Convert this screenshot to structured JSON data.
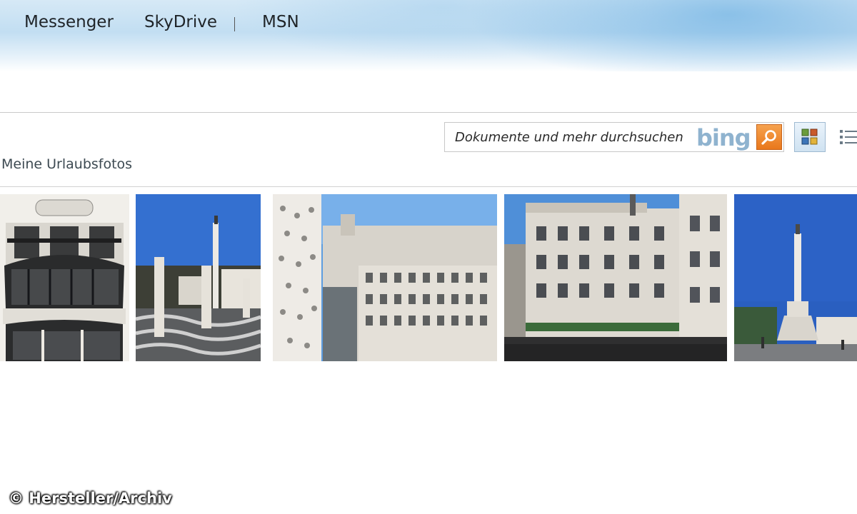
{
  "nav": {
    "items": [
      "Messenger",
      "SkyDrive",
      "MSN"
    ],
    "separator": "|"
  },
  "search": {
    "placeholder": "Dokumente und mehr durchsuchen",
    "provider": "bing",
    "button_icon": "magnifier-icon"
  },
  "view_buttons": {
    "tiles_icon": "thumbnail-view-icon",
    "list_icon": "list-view-icon"
  },
  "folder": {
    "title": "Meine Urlaubsfotos",
    "photo_count": 5
  },
  "colors": {
    "search_button": "#e9781c",
    "bing_logo": "#8fb3cf",
    "sky": "#2a5fc0"
  },
  "copyright": "© Hersteller/Archiv"
}
